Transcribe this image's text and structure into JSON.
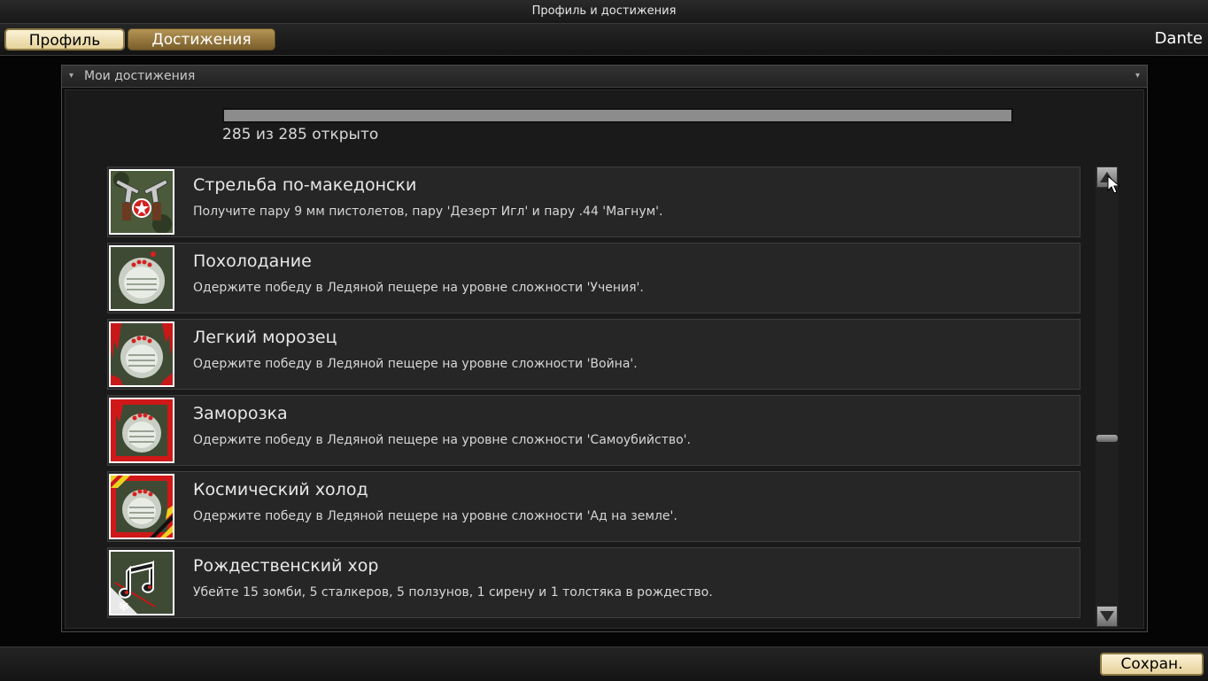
{
  "window": {
    "title": "Профиль и достижения"
  },
  "tabs": [
    {
      "label": "Профиль",
      "active": true
    },
    {
      "label": "Достижения",
      "active": false
    }
  ],
  "user": {
    "name": "Dante"
  },
  "panel": {
    "title": "Мои достижения"
  },
  "progress": {
    "unlocked": 285,
    "total": 285,
    "text": "285 из 285 открыто"
  },
  "achievements": [
    {
      "title": "Стрельба по-македонски",
      "description": "Получите пару 9 мм пистолетов, пару 'Дезерт Игл' и пару .44 'Магнум'.",
      "icon": "dual-pistols-icon"
    },
    {
      "title": "Похолодание",
      "description": "Одержите победу в Ледяной пещере на уровне сложности 'Учения'.",
      "icon": "ice-cave-icon"
    },
    {
      "title": "Легкий морозец",
      "description": "Одержите победу в Ледяной пещере на уровне сложности 'Война'.",
      "icon": "ice-cave-blood-icon"
    },
    {
      "title": "Заморозка",
      "description": "Одержите победу в Ледяной пещере на уровне сложности 'Самоубийство'.",
      "icon": "ice-cave-red-frame-icon"
    },
    {
      "title": "Космический холод",
      "description": "Одержите победу в Ледяной пещере на уровне сложности 'Ад на земле'.",
      "icon": "ice-cave-hazard-icon"
    },
    {
      "title": "Рождественский хор",
      "description": "Убейте 15 зомби, 5 сталкеров, 5 ползунов, 1 сирену и 1 толстяка в рождество.",
      "icon": "music-notes-icon"
    }
  ],
  "footer": {
    "save_label": "Сохран."
  },
  "colors": {
    "accent": "#e6d29a",
    "tab_inactive": "#8a6c34",
    "progress_fill": "#8c8c8c"
  }
}
